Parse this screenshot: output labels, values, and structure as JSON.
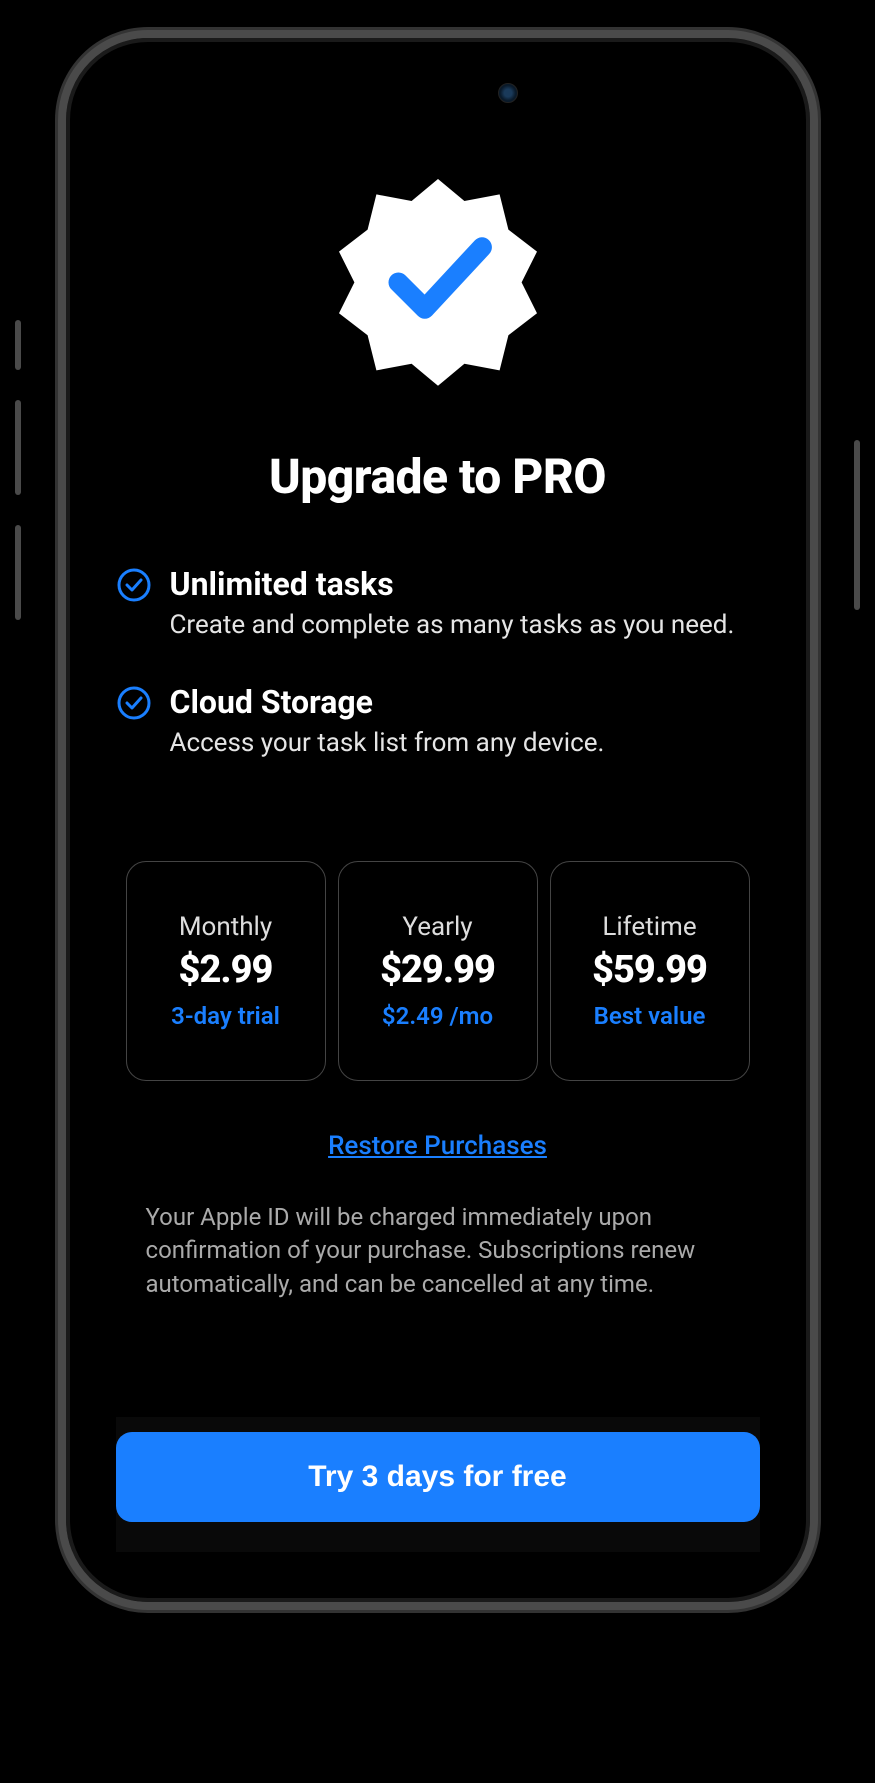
{
  "header": {
    "title": "Upgrade to PRO"
  },
  "features": [
    {
      "title": "Unlimited tasks",
      "description": "Create and complete as many tasks as you need."
    },
    {
      "title": "Cloud Storage",
      "description": "Access your task list from any device."
    }
  ],
  "plans": [
    {
      "label": "Monthly",
      "price": "$2.99",
      "sub": "3-day trial"
    },
    {
      "label": "Yearly",
      "price": "$29.99",
      "sub": "$2.49 /mo"
    },
    {
      "label": "Lifetime",
      "price": "$59.99",
      "sub": "Best value"
    }
  ],
  "restore": {
    "label": "Restore Purchases"
  },
  "disclaimer": "Your Apple ID will be charged immediately upon confirmation of your purchase. Subscriptions renew automatically, and can be cancelled at any time.",
  "cta": {
    "label": "Try 3 days for free"
  },
  "colors": {
    "accent": "#1a7fff"
  }
}
